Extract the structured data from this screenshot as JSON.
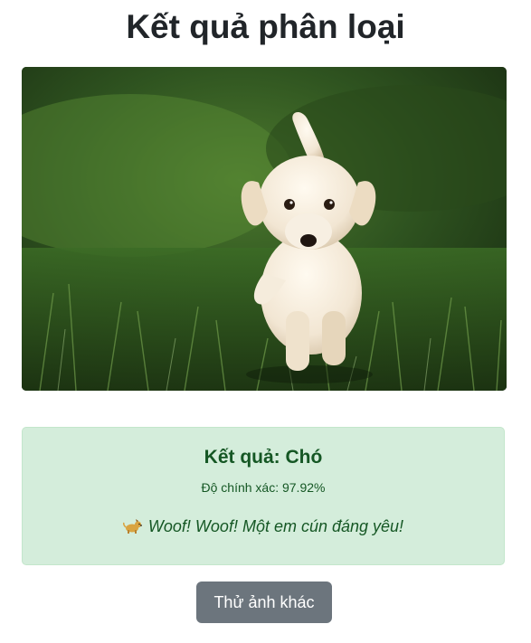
{
  "header": {
    "title": "Kết quả phân loại"
  },
  "image": {
    "subject": "puppy on grass"
  },
  "result": {
    "label_text": "Kết quả: Chó",
    "accuracy_text": "Độ chính xác: 97.92%",
    "message_text": "Woof! Woof! Một em cún đáng yêu!",
    "icon": "dog-icon",
    "bg_color": "#d4eddb",
    "text_color": "#155724"
  },
  "actions": {
    "retry_label": "Thử ảnh khác",
    "retry_color": "#6c757d"
  }
}
